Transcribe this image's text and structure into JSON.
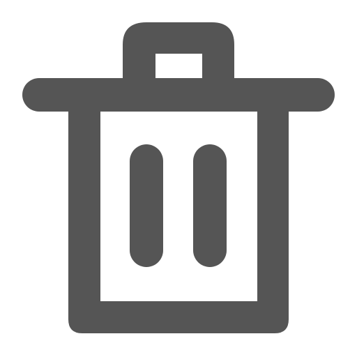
{
  "icon": {
    "name": "trash-icon",
    "color": "#555555",
    "background": "#ffffff"
  }
}
